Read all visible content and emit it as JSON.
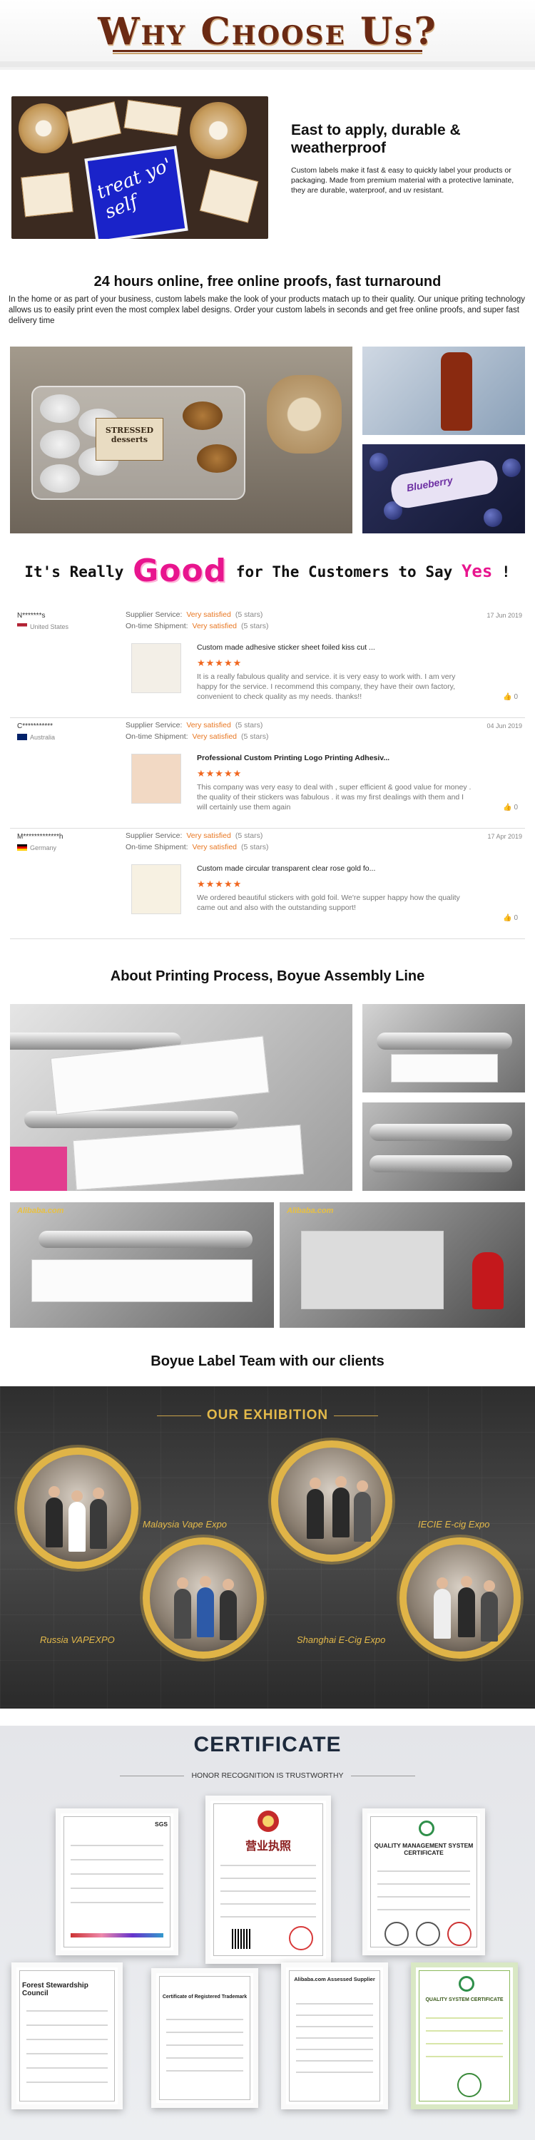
{
  "header": {
    "title": "Why Choose Us?"
  },
  "feature1": {
    "title": "East to apply, durable & weatherproof",
    "body": "Custom labels make it fast & easy to quickly label your products or packaging.  Made from premium material with a protective laminate, they are durable, waterproof, and uv resistant.",
    "image_text": "treat yo' self"
  },
  "feature2": {
    "title": "24 hours online, free online proofs, fast turnaround",
    "body": "In the home or as part of your business, custom labels make the look of your products matach up to their quality. Our unique priting technology allows us to easily print even the most complex label designs. Order your custom labels in seconds and get free online proofs, and super fast delivery time",
    "image_text_main": "STRESSED desserts",
    "image_text_blue": "Blueberry"
  },
  "reviews": {
    "heading_pre": "It's Really",
    "heading_good": "Good",
    "heading_mid": "for The Customers to Say",
    "heading_yes": "Yes",
    "heading_end": "!",
    "supplier_label": "Supplier Service:",
    "shipment_label": "On-time Shipment:",
    "items": [
      {
        "name": "N*******s",
        "country": "United States",
        "date": "17 Jun 2019",
        "supplier_value": "Very satisfied",
        "supplier_stars": "(5 stars)",
        "shipment_value": "Very satisfied",
        "shipment_stars": "(5 stars)",
        "product": "Custom made adhesive sticker sheet foiled kiss cut ...",
        "stars": "★★★★★",
        "text": "It is a really fabulous quality and service. it is very easy to work with. I am very happy for the service. I recommend this company, they have their own factory, convenient to check quality as my needs. thanks!!",
        "likes": "0"
      },
      {
        "name": "C***********",
        "country": "Australia",
        "date": "04 Jun 2019",
        "supplier_value": "Very satisfied",
        "supplier_stars": "(5 stars)",
        "shipment_value": "Very satisfied",
        "shipment_stars": "(5 stars)",
        "product": "Professional Custom Printing Logo Printing Adhesiv...",
        "stars": "★★★★★",
        "text": "This company was very easy to deal with , super efficient & good value for money . the quality of their stickers was fabulous . it was my first dealings with them and I will certainly use them again",
        "likes": "0"
      },
      {
        "name": "M*************h",
        "country": "Germany",
        "date": "17 Apr 2019",
        "supplier_value": "Very satisfied",
        "supplier_stars": "(5 stars)",
        "shipment_value": "Very satisfied",
        "shipment_stars": "(5 stars)",
        "product": "Custom made circular transparent clear rose gold fo...",
        "stars": "★★★★★",
        "text": "We ordered beautiful stickers with gold foil. We're supper happy how the quality came out and also with the outstanding support!",
        "likes": "0"
      }
    ]
  },
  "process": {
    "title": "About Printing Process, Boyue Assembly Line",
    "watermark": "Alibaba.com"
  },
  "team": {
    "title": "Boyue Label Team with our clients",
    "exhibition_title": "OUR EXHIBITION",
    "expos": [
      "Malaysia Vape Expo",
      "IECIE E-cig Expo",
      "Russia VAPEXPO",
      "Shanghai E-Cig Expo"
    ]
  },
  "certificate": {
    "title": "CERTIFICATE",
    "subtitle": "HONOR RECOGNITION IS TRUSTWORTHY",
    "certs": [
      "SGS",
      "营业执照",
      "QUALITY MANAGEMENT SYSTEM CERTIFICATE",
      "Forest Stewardship Council",
      "Certificate of Registered Trademark",
      "Alibaba.com Assessed Supplier",
      "QUALITY SYSTEM CERTIFICATE"
    ]
  },
  "colors": {
    "title_brown": "#6b2a14",
    "accent_pink": "#e8158e",
    "accent_orange": "#e87722",
    "gold": "#e3b94a",
    "navy": "#1d2a3c"
  }
}
